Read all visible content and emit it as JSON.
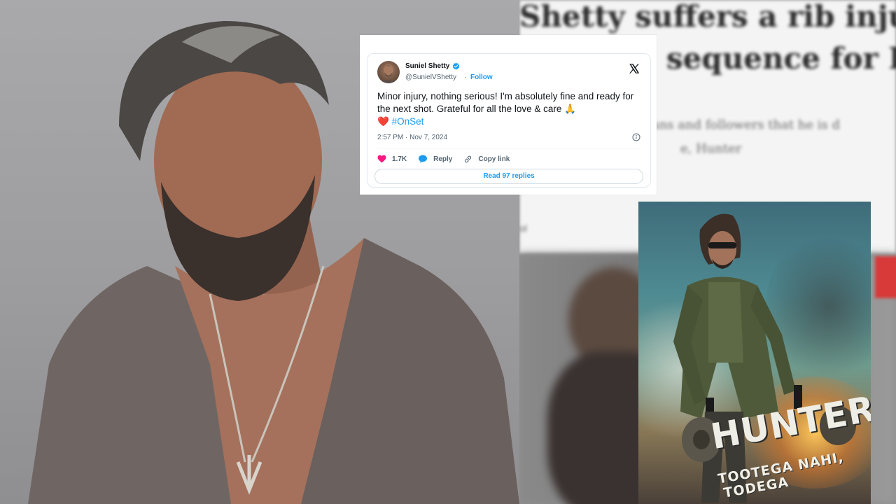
{
  "article": {
    "headline_line1": "Shetty suffers a rib inju",
    "headline_line2": "sequence for H",
    "body_line1": "his fans and followers that he is d",
    "body_line2": "e, Hunter",
    "small_text": "ol"
  },
  "tweet": {
    "author_name": "Suniel Shetty",
    "handle": "@SunielVShetty",
    "separator": "·",
    "follow_label": "Follow",
    "text": "Minor injury, nothing serious! I'm absolutely fine and ready for the next shot. Grateful for all the love & care 🙏",
    "text_line2_emoji": "❤️",
    "hashtag": "#OnSet",
    "timestamp": "2:57 PM · Nov 7, 2024",
    "likes": "1.7K",
    "reply_label": "Reply",
    "copy_link_label": "Copy link",
    "read_replies_label": "Read 97 replies",
    "colors": {
      "accent": "#1d9bf0",
      "like": "#f91880",
      "text": "#0f1419",
      "muted": "#536471"
    },
    "icons": [
      "verified-badge-icon",
      "x-logo-icon",
      "info-icon",
      "heart-icon",
      "reply-bubble-icon",
      "link-icon"
    ]
  },
  "poster": {
    "title": "HUNTER",
    "tagline_line1": "TOOTEGA NAHI,",
    "tagline_line2": "TODEGA"
  }
}
